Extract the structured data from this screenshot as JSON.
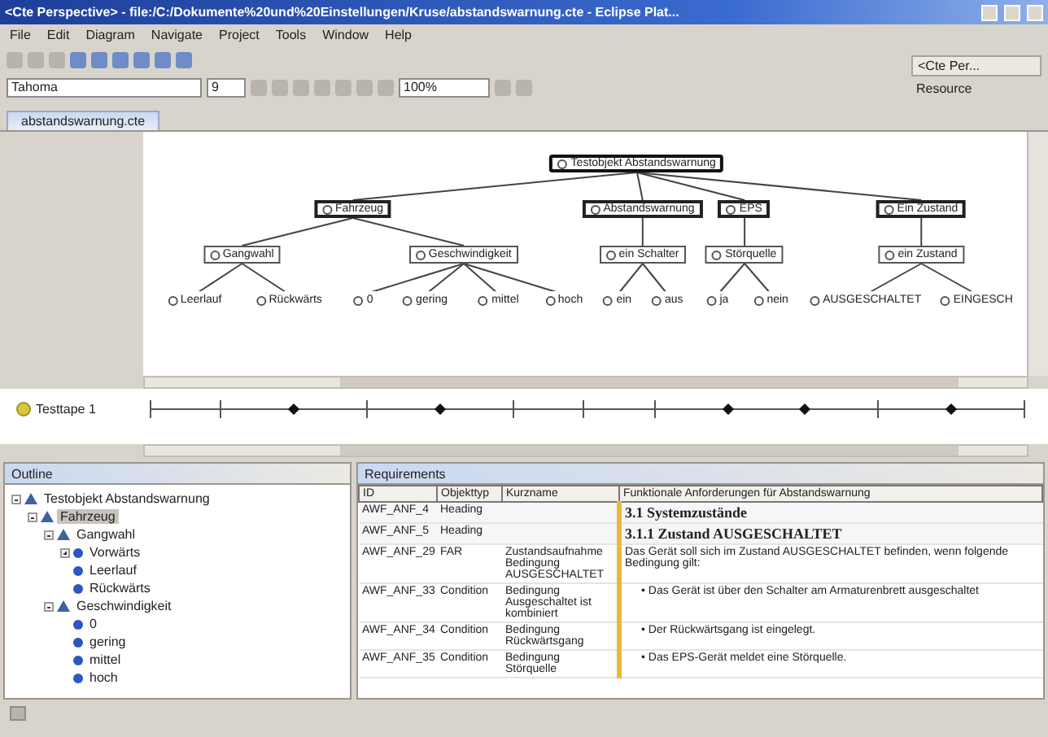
{
  "window": {
    "title": "<Cte Perspective> - file:/C:/Dokumente%20und%20Einstellungen/Kruse/abstandswarnung.cte - Eclipse Plat..."
  },
  "menu": [
    "File",
    "Edit",
    "Diagram",
    "Navigate",
    "Project",
    "Tools",
    "Window",
    "Help"
  ],
  "toolbar": {
    "font": "Tahoma",
    "size": "9",
    "zoom": "100%"
  },
  "perspectives": [
    {
      "label": "<Cte Per...",
      "selected": true
    },
    {
      "label": "Resource",
      "selected": false
    }
  ],
  "editor_tab": {
    "label": "abstandswarnung.cte"
  },
  "diagram": {
    "label": "Testobjekt Abstandswarnung",
    "kind": "root",
    "children": [
      {
        "label": "Fahrzeug",
        "kind": "category",
        "children": [
          {
            "label": "Gangwahl",
            "kind": "group",
            "children": [
              {
                "label": "Leerlauf",
                "kind": "leaf"
              },
              {
                "label": "Rückwärts",
                "kind": "leaf"
              }
            ]
          },
          {
            "label": "Geschwindigkeit",
            "kind": "group",
            "children": [
              {
                "label": "0",
                "kind": "leaf"
              },
              {
                "label": "gering",
                "kind": "leaf"
              },
              {
                "label": "mittel",
                "kind": "leaf"
              },
              {
                "label": "hoch",
                "kind": "leaf"
              }
            ]
          }
        ]
      },
      {
        "label": "Abstandswarnung",
        "kind": "category",
        "children": [
          {
            "label": "ein Schalter",
            "kind": "group",
            "children": [
              {
                "label": "ein",
                "kind": "leaf"
              },
              {
                "label": "aus",
                "kind": "leaf"
              }
            ]
          }
        ]
      },
      {
        "label": "EPS",
        "kind": "category",
        "children": [
          {
            "label": "Störquelle",
            "kind": "group",
            "children": [
              {
                "label": "ja",
                "kind": "leaf"
              },
              {
                "label": "nein",
                "kind": "leaf"
              }
            ]
          }
        ]
      },
      {
        "label": "Ein Zustand",
        "kind": "category",
        "children": [
          {
            "label": "ein Zustand",
            "kind": "group",
            "children": [
              {
                "label": "AUSGESCHALTET",
                "kind": "leaf"
              },
              {
                "label": "EINGESCH",
                "kind": "leaf"
              }
            ]
          }
        ]
      }
    ]
  },
  "testtape": {
    "label": "Testtape 1",
    "marks": [
      {
        "kind": "tick"
      },
      {
        "kind": "tick"
      },
      {
        "kind": "diamond"
      },
      {
        "kind": "tick"
      },
      {
        "kind": "diamond"
      },
      {
        "kind": "tick"
      },
      {
        "kind": "tick"
      },
      {
        "kind": "tick"
      },
      {
        "kind": "diamond"
      },
      {
        "kind": "diamond"
      },
      {
        "kind": "tick"
      },
      {
        "kind": "diamond"
      },
      {
        "kind": "tick"
      }
    ]
  },
  "outline": {
    "title": "Outline",
    "tree": [
      {
        "label": "Testobjekt Abstandswarnung",
        "kind": "classification",
        "expanded": true,
        "selected": false,
        "children": [
          {
            "label": "Fahrzeug",
            "kind": "classification",
            "expanded": true,
            "selected": true,
            "children": [
              {
                "label": "Gangwahl",
                "kind": "classification",
                "expanded": true,
                "selected": false,
                "children": [
                  {
                    "label": "Vorwärts",
                    "kind": "class",
                    "expanded": false,
                    "selected": false
                  },
                  {
                    "label": "Leerlauf",
                    "kind": "class",
                    "selected": false
                  },
                  {
                    "label": "Rückwärts",
                    "kind": "class",
                    "selected": false
                  }
                ]
              },
              {
                "label": "Geschwindigkeit",
                "kind": "classification",
                "expanded": true,
                "selected": false,
                "children": [
                  {
                    "label": "0",
                    "kind": "class",
                    "selected": false
                  },
                  {
                    "label": "gering",
                    "kind": "class",
                    "selected": false
                  },
                  {
                    "label": "mittel",
                    "kind": "class",
                    "selected": false
                  },
                  {
                    "label": "hoch",
                    "kind": "class",
                    "selected": false
                  }
                ]
              }
            ]
          }
        ]
      }
    ]
  },
  "requirements": {
    "title": "Requirements",
    "columns": [
      "ID",
      "Objekttyp",
      "Kurzname",
      "Funktionale Anforderungen für Abstandswarnung"
    ],
    "rows": [
      {
        "kind": "heading",
        "cells": [
          "AWF_ANF_4",
          "Heading",
          "",
          "3.1 Systemzustände"
        ]
      },
      {
        "kind": "heading",
        "cells": [
          "AWF_ANF_5",
          "Heading",
          "",
          "3.1.1 Zustand AUSGESCHALTET"
        ]
      },
      {
        "kind": "text",
        "cells": [
          "AWF_ANF_29",
          "FAR",
          "Zustandsaufnahme Bedingung AUSGESCHALTET",
          "Das Gerät soll sich im Zustand AUSGESCHALTET befinden, wenn folgende Bedingung gilt:"
        ]
      },
      {
        "kind": "bullet",
        "cells": [
          "AWF_ANF_33",
          "Condition",
          "Bedingung Ausgeschaltet ist kombiniert",
          "• Das Gerät ist über den Schalter am Armaturenbrett ausgeschaltet"
        ]
      },
      {
        "kind": "bullet",
        "cells": [
          "AWF_ANF_34",
          "Condition",
          "Bedingung Rückwärtsgang",
          "• Der Rückwärtsgang ist eingelegt."
        ]
      },
      {
        "kind": "bullet",
        "cells": [
          "AWF_ANF_35",
          "Condition",
          "Bedingung Störquelle",
          "• Das EPS-Gerät meldet eine Störquelle."
        ]
      }
    ]
  }
}
